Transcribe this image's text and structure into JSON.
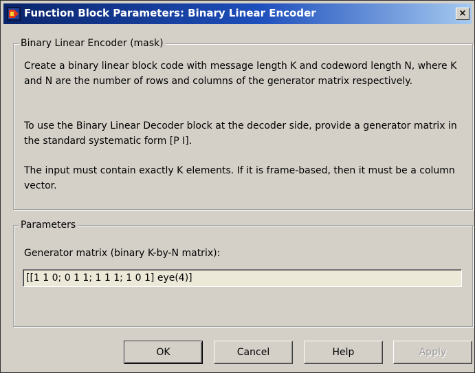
{
  "window": {
    "title": "Function Block Parameters: Binary Linear Encoder",
    "close_label": "×"
  },
  "description_group": {
    "legend": "Binary Linear Encoder (mask)",
    "paragraphs": [
      "Create a binary linear block code with message length K and codeword length N, where K and N are the number of rows and columns of the generator matrix respectively.",
      "To use the Binary Linear Decoder block at the decoder side, provide a generator matrix in the standard systematic form [P I].",
      "The input must contain exactly K elements.  If it is frame-based, then it must be a column vector."
    ]
  },
  "parameters_group": {
    "legend": "Parameters",
    "generator_matrix_label": "Generator matrix (binary K-by-N matrix):",
    "generator_matrix_value": "[[1 1 0; 0 1 1; 1 1 1; 1 0 1] eye(4)]"
  },
  "buttons": {
    "ok": "OK",
    "cancel": "Cancel",
    "help": "Help",
    "apply": "Apply"
  },
  "colors": {
    "title_bar_start": "#0a246a",
    "title_bar_end": "#a6caf0",
    "dialog_background": "#d4d0c8",
    "disabled_text": "#9a9a9a"
  },
  "icons": {
    "title": "simulink-block-icon",
    "close": "close-icon"
  }
}
